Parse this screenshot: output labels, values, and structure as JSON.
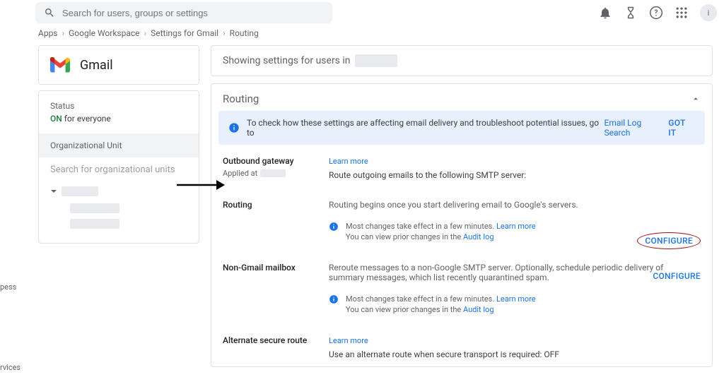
{
  "search": {
    "placeholder": "Search for users, groups or settings"
  },
  "topbar_icons": {
    "bell": "notifications-icon",
    "hourglass": "tasks-icon",
    "help": "help-icon",
    "apps": "apps-grid-icon",
    "profile_initial": "i"
  },
  "breadcrumbs": [
    "Apps",
    "Google Workspace",
    "Settings for Gmail",
    "Routing"
  ],
  "left": {
    "title": "Gmail",
    "status_label": "Status",
    "status_on": "ON",
    "status_suffix": " for everyone",
    "org_header": "Organizational Unit",
    "org_search_placeholder": "Search for organizational units"
  },
  "main": {
    "header_prefix": "Showing settings for users in ",
    "routing_title": "Routing",
    "banner": {
      "text": "To check how these settings are affecting email delivery and troubleshoot potential issues, go to",
      "link": "Email Log Search",
      "got_it": "GOT IT"
    },
    "sections": {
      "outbound": {
        "label": "Outbound gateway",
        "applied_at": "Applied at",
        "learn_more": "Learn more",
        "desc": "Route outgoing emails to the following SMTP server:"
      },
      "routing": {
        "label": "Routing",
        "desc": "Routing begins once you start delivering email to Google's servers.",
        "note1": "Most changes take effect in a few minutes.",
        "note1_link": "Learn more",
        "note2": "You can view prior changes in the",
        "note2_link": "Audit log",
        "configure": "CONFIGURE"
      },
      "nongmail": {
        "label": "Non-Gmail mailbox",
        "desc": "Reroute messages to a non-Google SMTP server. Optionally, schedule periodic delivery of summary messages, which list recently quarantined spam.",
        "note1": "Most changes take effect in a few minutes.",
        "note1_link": "Learn more",
        "note2": "You can view prior changes in the",
        "note2_link": "Audit log",
        "configure": "CONFIGURE"
      },
      "alt_secure": {
        "label": "Alternate secure route",
        "learn_more": "Learn more",
        "desc": "Use an alternate route when secure transport is required: OFF"
      }
    }
  },
  "side_texts": {
    "pess": "pess",
    "rvices": "rvices"
  }
}
